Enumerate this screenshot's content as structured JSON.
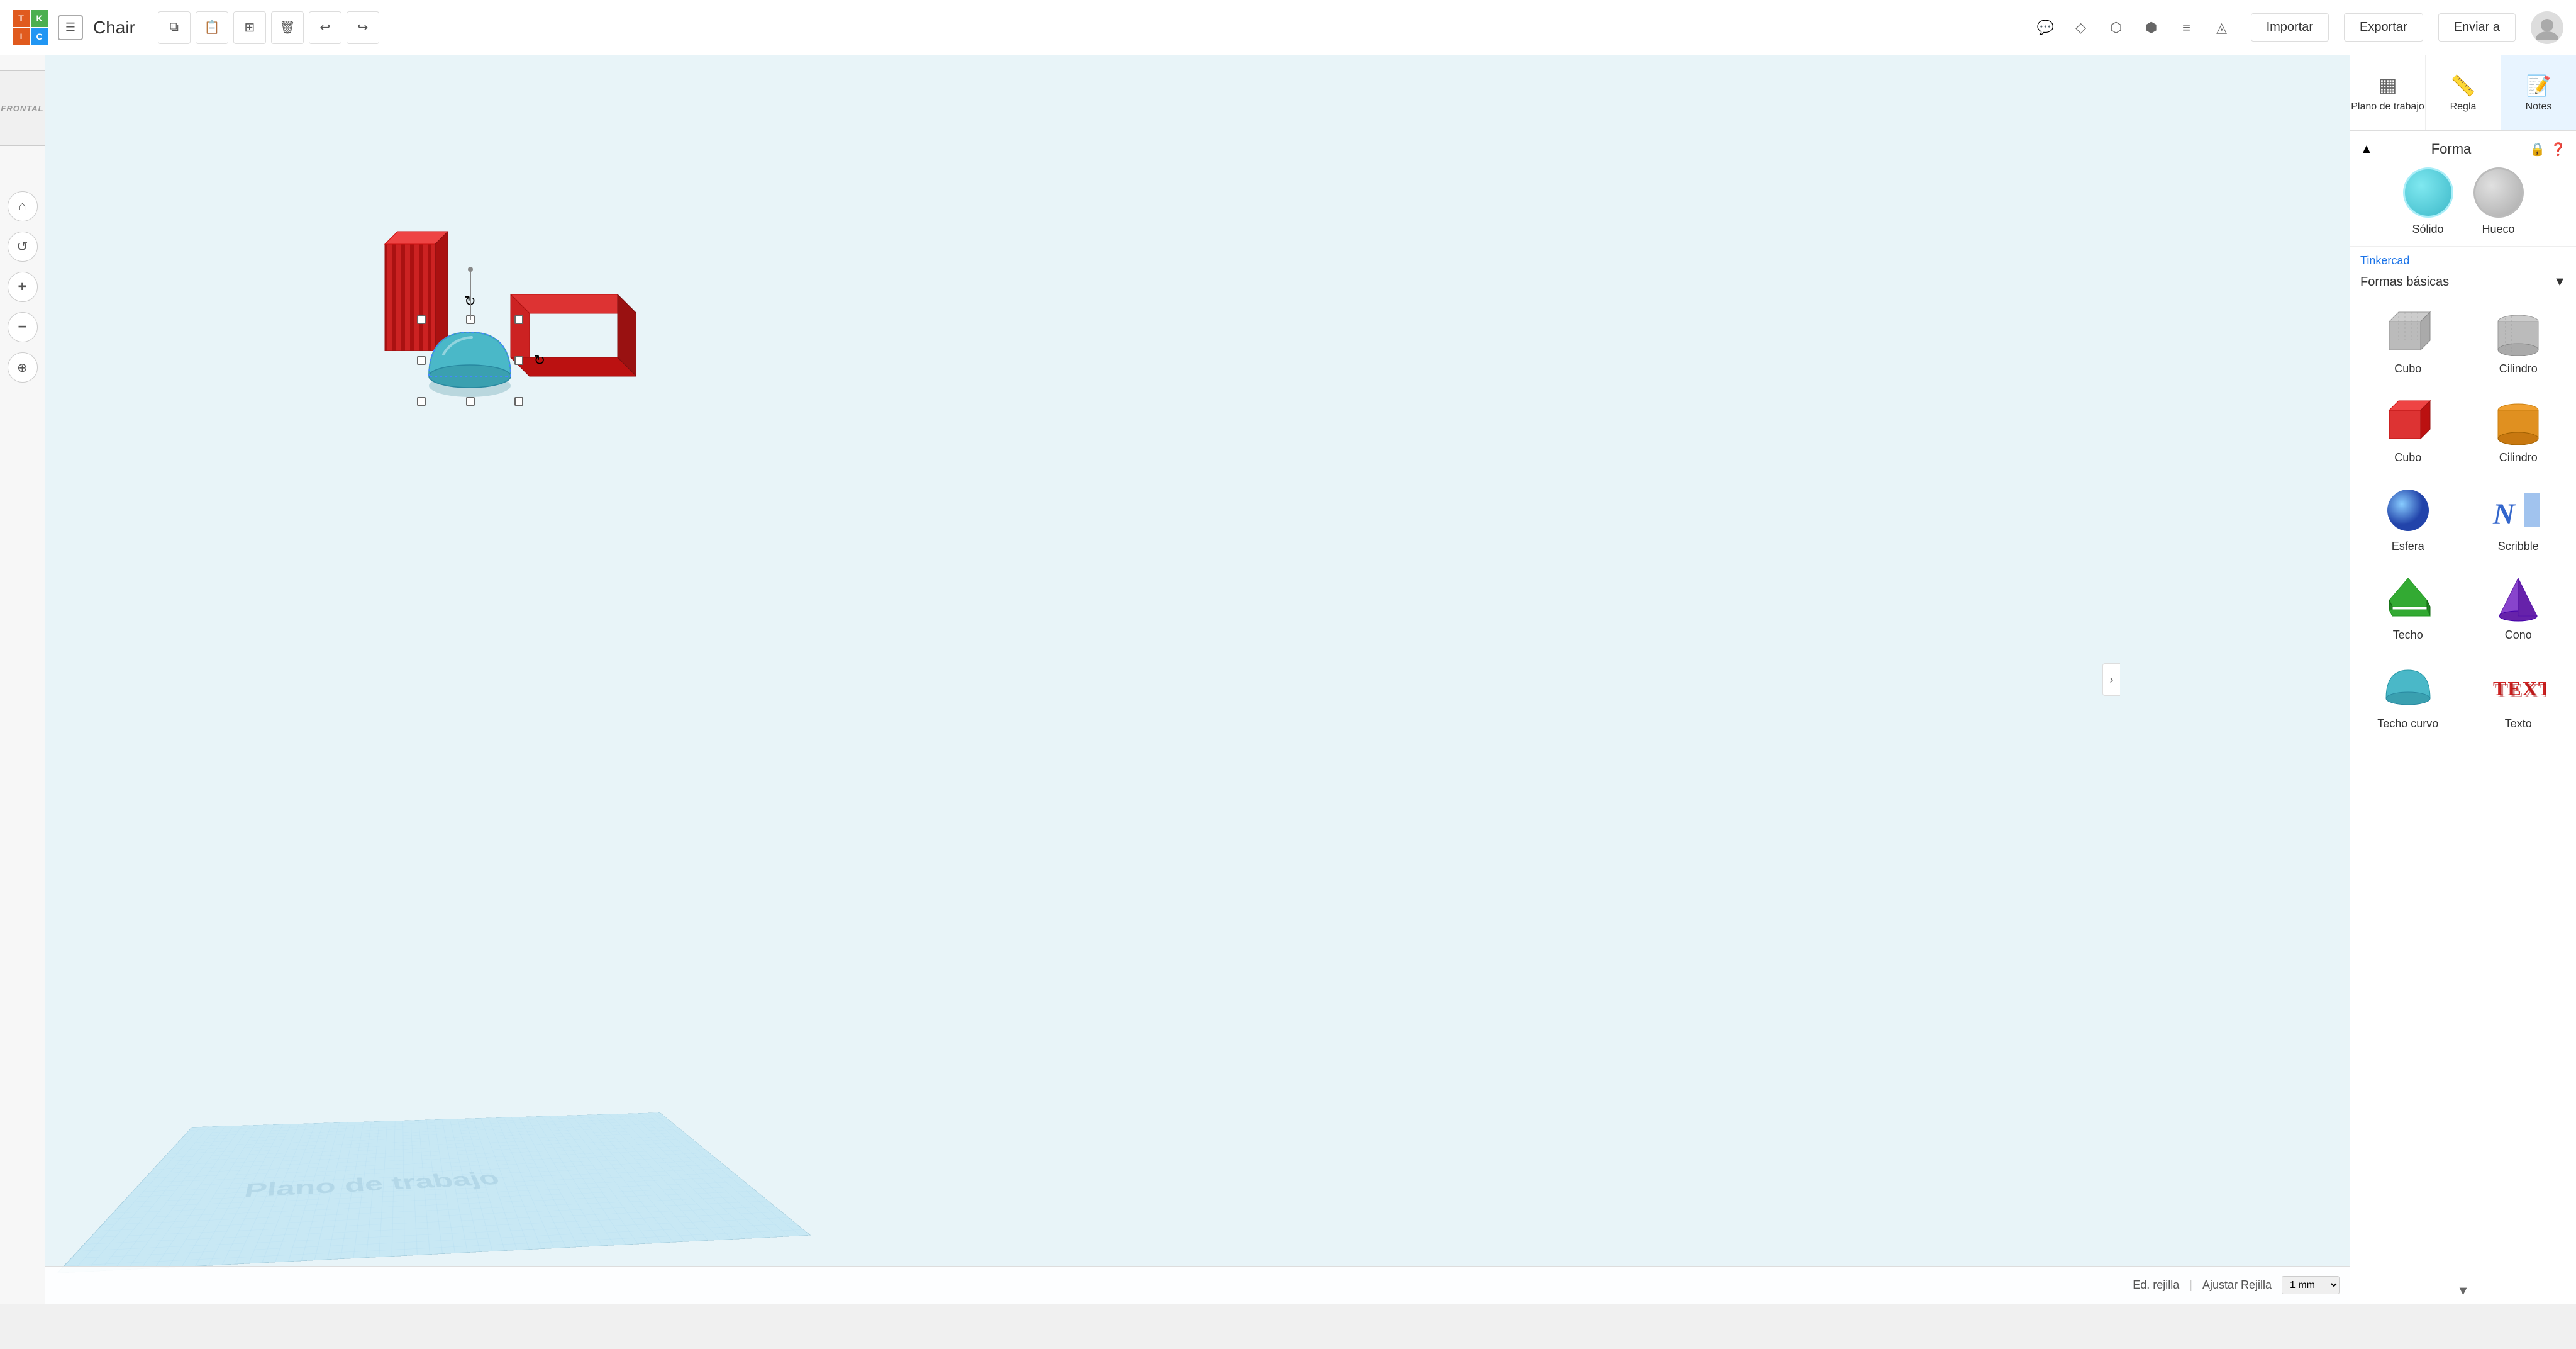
{
  "app": {
    "logo": {
      "t": "TIN",
      "k": "KER",
      "c": "CAD"
    },
    "project_icon": "☰",
    "project_title": "Chair"
  },
  "toolbar": {
    "btn_copy": "⧉",
    "btn_paste": "📋",
    "btn_duplicate": "⊞",
    "btn_delete": "🗑",
    "btn_undo": "↩",
    "btn_redo": "↪"
  },
  "topbar_right": {
    "tools": [
      "💬",
      "◇",
      "⬡",
      "⬢",
      "≡",
      "◬"
    ],
    "importar": "Importar",
    "exportar": "Exportar",
    "enviar": "Enviar a"
  },
  "right_tabs": [
    {
      "id": "plano",
      "label": "Plano de\ntrabajo",
      "icon": "▦"
    },
    {
      "id": "regla",
      "label": "Regla",
      "icon": "📏"
    },
    {
      "id": "notes",
      "label": "Notes",
      "icon": "📝",
      "active": true
    }
  ],
  "shape_panel": {
    "title": "Forma",
    "lock_icon": "🔒",
    "question_icon": "❓",
    "solid_label": "Sólido",
    "hollow_label": "Hueco"
  },
  "shapes_library": {
    "brand": "Tinkercad",
    "category": "Formas básicas",
    "shapes": [
      {
        "id": "cubo-gray",
        "label": "Cubo",
        "color": "gray"
      },
      {
        "id": "cilindro-gray",
        "label": "Cilindro",
        "color": "gray"
      },
      {
        "id": "cubo-red",
        "label": "Cubo",
        "color": "red"
      },
      {
        "id": "cilindro-orange",
        "label": "Cilindro",
        "color": "orange"
      },
      {
        "id": "esfera-blue",
        "label": "Esfera",
        "color": "blue"
      },
      {
        "id": "scribble",
        "label": "Scribble",
        "color": "blue"
      },
      {
        "id": "techo-green",
        "label": "Techo",
        "color": "green"
      },
      {
        "id": "cono-purple",
        "label": "Cono",
        "color": "purple"
      },
      {
        "id": "techo-curvo",
        "label": "Techo curvo",
        "color": "teal"
      },
      {
        "id": "texto",
        "label": "Texto",
        "color": "red"
      }
    ]
  },
  "status_bar": {
    "ed_rejilla": "Ed. rejilla",
    "ajustar_rejilla": "Ajustar Rejilla",
    "grid_value": "1 mm"
  },
  "canvas": {
    "grid_label": "Plano de trabajo"
  },
  "left_panel": {
    "buttons": [
      "⌂",
      "↺",
      "+",
      "−",
      "⊕"
    ]
  },
  "front_view": {
    "label": "FRONTAL"
  }
}
